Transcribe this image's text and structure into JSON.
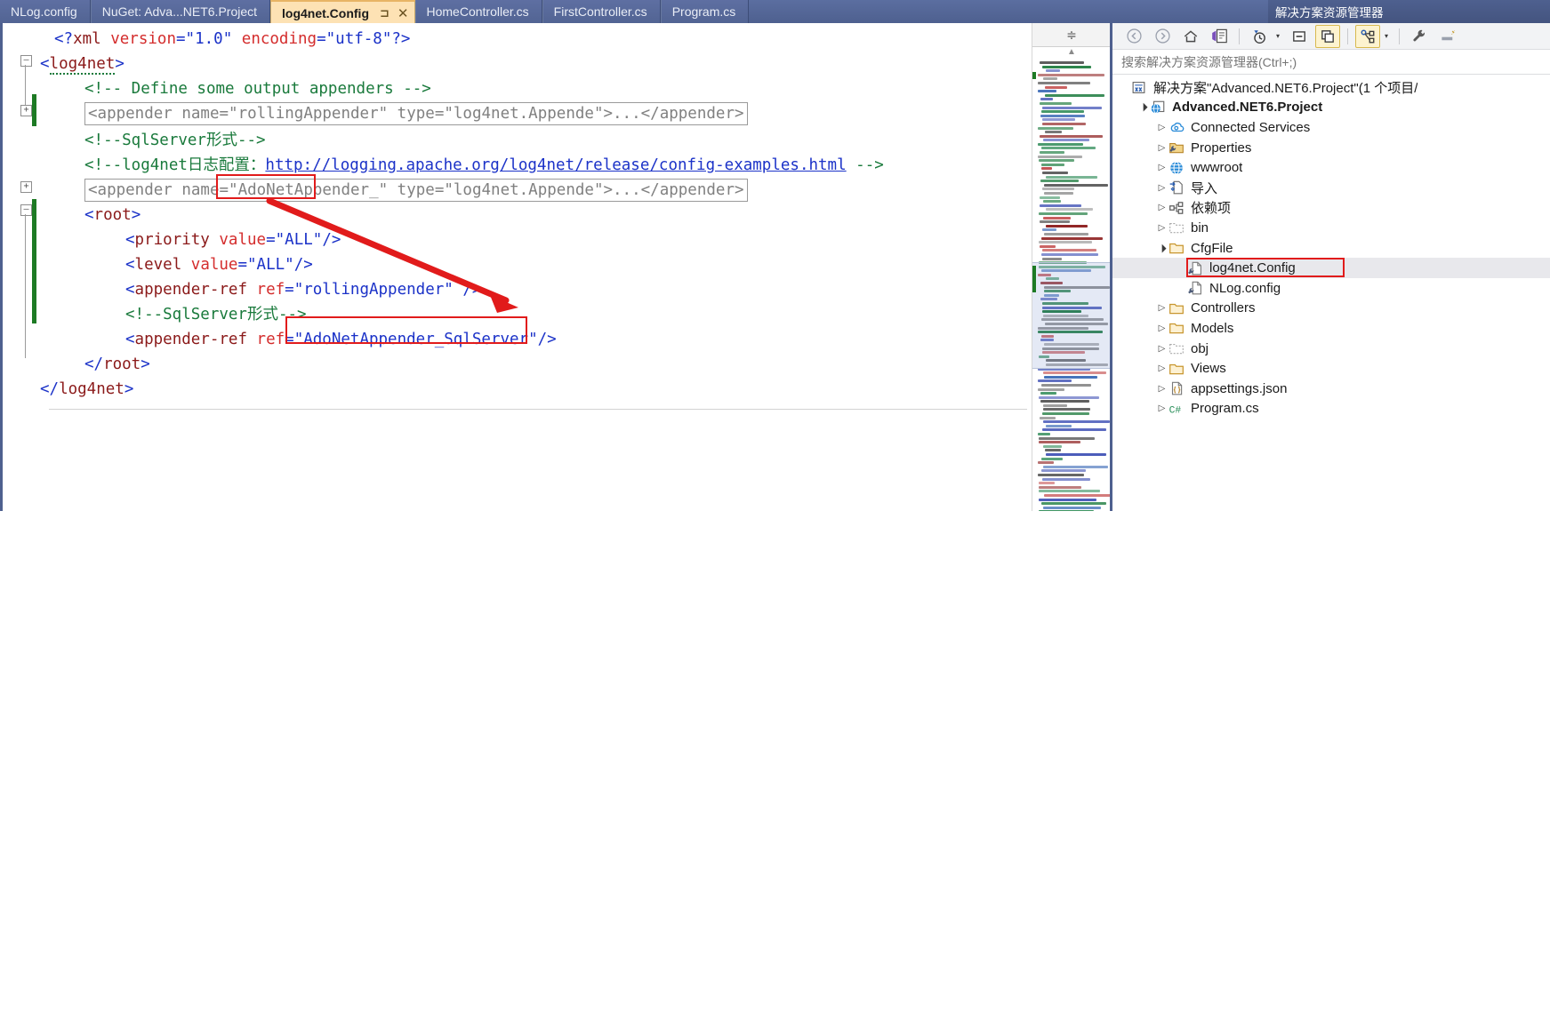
{
  "tabs": [
    {
      "label": "NLog.config",
      "active": false
    },
    {
      "label": "NuGet: Adva...NET6.Project",
      "active": false
    },
    {
      "label": "log4net.Config",
      "active": true,
      "pin": "⊐",
      "close": "✕"
    },
    {
      "label": "HomeController.cs",
      "active": false
    },
    {
      "label": "FirstController.cs",
      "active": false
    },
    {
      "label": "Program.cs",
      "active": false
    }
  ],
  "tabstrip_controls": [
    {
      "name": "chevron-double-left-icon",
      "glyph": "«"
    },
    {
      "name": "tab-list-dropdown-icon",
      "glyph": "▼"
    },
    {
      "name": "gear-icon",
      "glyph": "⚙"
    }
  ],
  "solution_explorer": {
    "title": "解决方案资源管理器",
    "search_placeholder": "搜索解决方案资源管理器(Ctrl+;)",
    "search_value": "",
    "toolbar": [
      {
        "name": "back-button",
        "glyph": "⬅",
        "selected": false
      },
      {
        "name": "forward-button",
        "glyph": "➡",
        "selected": false
      },
      {
        "name": "home-button",
        "glyph": "⌂",
        "selected": false
      },
      {
        "name": "vs-file-button",
        "glyph": "🗎",
        "selected": false
      },
      {
        "name": "pending-changes-clock-button",
        "glyph": "◷",
        "selected": false,
        "caret": "▾"
      },
      {
        "name": "collapse-all-button",
        "glyph": "⊟",
        "selected": false
      },
      {
        "name": "show-all-files-button",
        "glyph": "❐",
        "selected": true
      },
      {
        "name": "properties-graph-button",
        "glyph": "⚯",
        "selected": true,
        "caret": "▾"
      },
      {
        "name": "wrench-button",
        "glyph": "🔧",
        "selected": false
      },
      {
        "name": "preview-selected-items-button",
        "glyph": "▭",
        "selected": false
      }
    ],
    "tree": [
      {
        "label": "解决方案\"Advanced.NET6.Project\"(1 个项目/",
        "indent": 0,
        "twisty": "",
        "icon": "solution-icon",
        "bold": false,
        "selected": false,
        "boxed": false
      },
      {
        "label": "Advanced.NET6.Project",
        "indent": 1,
        "twisty": "▲",
        "icon": "web-project-icon",
        "bold": true,
        "selected": false,
        "boxed": false
      },
      {
        "label": "Connected Services",
        "indent": 2,
        "twisty": "▶",
        "icon": "connected-services-icon",
        "bold": false,
        "selected": false,
        "boxed": false
      },
      {
        "label": "Properties",
        "indent": 2,
        "twisty": "▶",
        "icon": "properties-icon",
        "bold": false,
        "selected": false,
        "boxed": false
      },
      {
        "label": "wwwroot",
        "indent": 2,
        "twisty": "▶",
        "icon": "wwwroot-globe-icon",
        "bold": false,
        "selected": false,
        "boxed": false
      },
      {
        "label": "导入",
        "indent": 2,
        "twisty": "▶",
        "icon": "import-icon",
        "bold": false,
        "selected": false,
        "boxed": false
      },
      {
        "label": "依赖项",
        "indent": 2,
        "twisty": "▶",
        "icon": "dependencies-icon",
        "bold": false,
        "selected": false,
        "boxed": false
      },
      {
        "label": "bin",
        "indent": 2,
        "twisty": "▶",
        "icon": "hidden-folder-icon",
        "bold": false,
        "selected": false,
        "boxed": false
      },
      {
        "label": "CfgFile",
        "indent": 2,
        "twisty": "▲",
        "icon": "folder-icon",
        "bold": false,
        "selected": false,
        "boxed": false
      },
      {
        "label": "log4net.Config",
        "indent": 3,
        "twisty": "",
        "icon": "config-file-icon",
        "bold": false,
        "selected": true,
        "boxed": true
      },
      {
        "label": "NLog.config",
        "indent": 3,
        "twisty": "",
        "icon": "config-file-icon",
        "bold": false,
        "selected": false,
        "boxed": false
      },
      {
        "label": "Controllers",
        "indent": 2,
        "twisty": "▶",
        "icon": "folder-icon",
        "bold": false,
        "selected": false,
        "boxed": false
      },
      {
        "label": "Models",
        "indent": 2,
        "twisty": "▶",
        "icon": "folder-icon",
        "bold": false,
        "selected": false,
        "boxed": false
      },
      {
        "label": "obj",
        "indent": 2,
        "twisty": "▶",
        "icon": "hidden-folder-icon",
        "bold": false,
        "selected": false,
        "boxed": false
      },
      {
        "label": "Views",
        "indent": 2,
        "twisty": "▶",
        "icon": "folder-icon",
        "bold": false,
        "selected": false,
        "boxed": false
      },
      {
        "label": "appsettings.json",
        "indent": 2,
        "twisty": "▶",
        "icon": "json-file-icon",
        "bold": false,
        "selected": false,
        "boxed": false
      },
      {
        "label": "Program.cs",
        "indent": 2,
        "twisty": "▶",
        "icon": "csharp-file-icon",
        "bold": false,
        "selected": false,
        "boxed": false
      }
    ]
  },
  "editor": {
    "file": "log4net.Config",
    "lines": [
      {
        "indent": 2,
        "type": "pi",
        "text": "<?xml version=\"1.0\" encoding=\"utf-8\"?>"
      },
      {
        "indent": 0,
        "type": "tag",
        "text": "<log4net>"
      },
      {
        "indent": 4,
        "type": "comment",
        "text": "<!-- Define some output appenders -->"
      },
      {
        "indent": 2,
        "type": "collapsed",
        "text": "<appender name=\"rollingAppender\" type=\"log4net.Appende\">...</appender>"
      },
      {
        "indent": 2,
        "type": "comment",
        "text": "<!--SqlServer形式-->"
      },
      {
        "indent": 2,
        "type": "comment-link",
        "prefix": "<!--log4net日志配置：",
        "link": "http://logging.apache.org/log4net/release/config-examples.html",
        "suffix": " -->"
      },
      {
        "indent": 2,
        "type": "collapsed",
        "text": "<appender name=\"AdoNetAppender_\" type=\"log4net.Appende\">...</appender>"
      },
      {
        "indent": 2,
        "type": "tag",
        "text": "<root>"
      },
      {
        "indent": 6,
        "type": "element",
        "text": "<priority value=\"ALL\"/>"
      },
      {
        "indent": 6,
        "type": "element",
        "text": "<level value=\"ALL\"/>"
      },
      {
        "indent": 6,
        "type": "element",
        "text": "<appender-ref ref=\"rollingAppender\" />"
      },
      {
        "indent": 6,
        "type": "comment",
        "text": "<!--SqlServer形式-->"
      },
      {
        "indent": 6,
        "type": "element",
        "text": "<appender-ref ref=\"AdoNetAppender_SqlServer\"/>"
      },
      {
        "indent": 2,
        "type": "tag",
        "text": "</root>"
      },
      {
        "indent": 0,
        "type": "tag",
        "text": "</log4net>"
      }
    ],
    "annotations": {
      "highlight_source": "AdoNetAppender_",
      "highlight_target": "AdoNetAppender_SqlServer",
      "arrow_color": "#e11b1b"
    }
  },
  "colors": {
    "tab_active_bg": "#fde2b4",
    "chrome_blue": "#4e608f",
    "annotation_red": "#e11b1b",
    "xml_tag": "#8b1a1a",
    "xml_attr": "#d42d2d",
    "xml_value": "#1b32c8",
    "xml_comment": "#1a7a3c",
    "collapsed_gray": "#808080",
    "change_bar_green": "#1d7a24"
  }
}
